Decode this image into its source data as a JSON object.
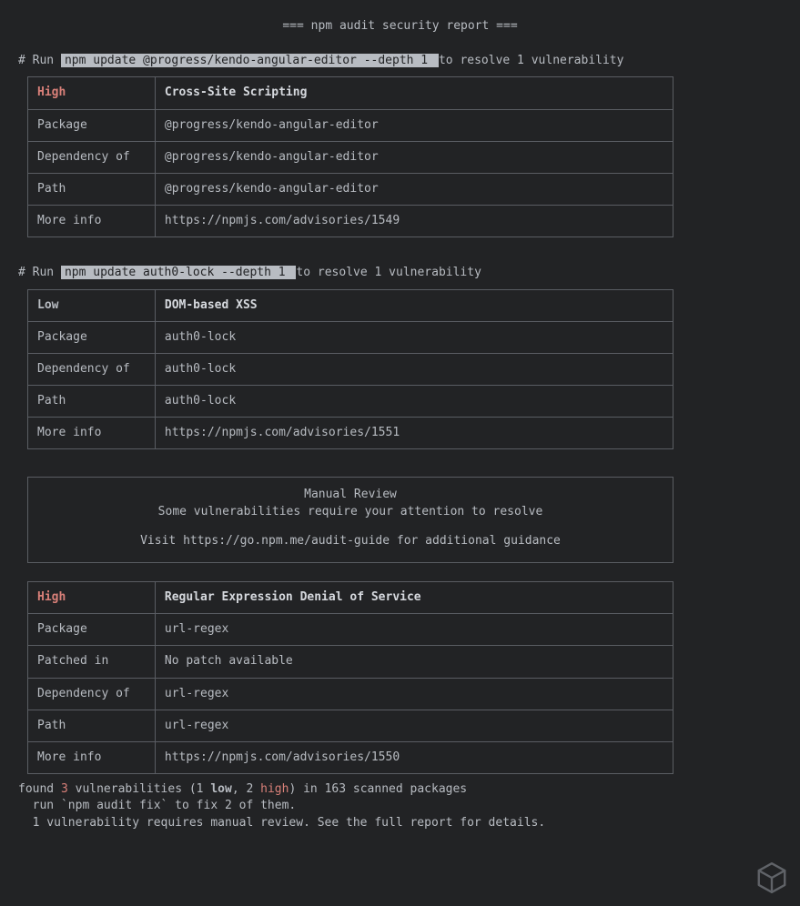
{
  "header": "=== npm audit security report ===",
  "labels": {
    "run_prefix": "# Run ",
    "package": "Package",
    "dependency_of": "Dependency of",
    "path": "Path",
    "more_info": "More info",
    "patched_in": "Patched in"
  },
  "vulns": [
    {
      "cmd": " npm update @progress/kendo-angular-editor --depth 1 ",
      "resolve": " to resolve 1 vulnerability",
      "severity": "High",
      "sev_class": "sev-high",
      "title": "Cross-Site Scripting",
      "package": "@progress/kendo-angular-editor",
      "dependency_of": "@progress/kendo-angular-editor",
      "path": "@progress/kendo-angular-editor",
      "more_info": "https://npmjs.com/advisories/1549"
    },
    {
      "cmd": " npm update auth0-lock --depth 1 ",
      "resolve": " to resolve 1 vulnerability",
      "severity": "Low",
      "sev_class": "sev-low",
      "title": "DOM-based XSS",
      "package": "auth0-lock",
      "dependency_of": "auth0-lock",
      "path": "auth0-lock",
      "more_info": "https://npmjs.com/advisories/1551"
    }
  ],
  "manual_review": {
    "line1": "Manual Review",
    "line2": "Some vulnerabilities require your attention to resolve",
    "line3": "Visit https://go.npm.me/audit-guide for additional guidance"
  },
  "manual_vuln": {
    "severity": "High",
    "sev_class": "sev-high",
    "title": "Regular Expression Denial of Service",
    "package": "url-regex",
    "patched_in": "No patch available",
    "dependency_of": "url-regex",
    "path": "url-regex",
    "more_info": "https://npmjs.com/advisories/1550"
  },
  "summary": {
    "found_prefix": "found ",
    "total": "3",
    "after_total": " vulnerabilities (1 ",
    "low_word": "low",
    "mid": ", 2 ",
    "high_word": "high",
    "after_high": ") in 163 scanned packages",
    "line2": "  run `npm audit fix` to fix 2 of them.",
    "line3": "  1 vulnerability requires manual review. See the full report for details."
  }
}
